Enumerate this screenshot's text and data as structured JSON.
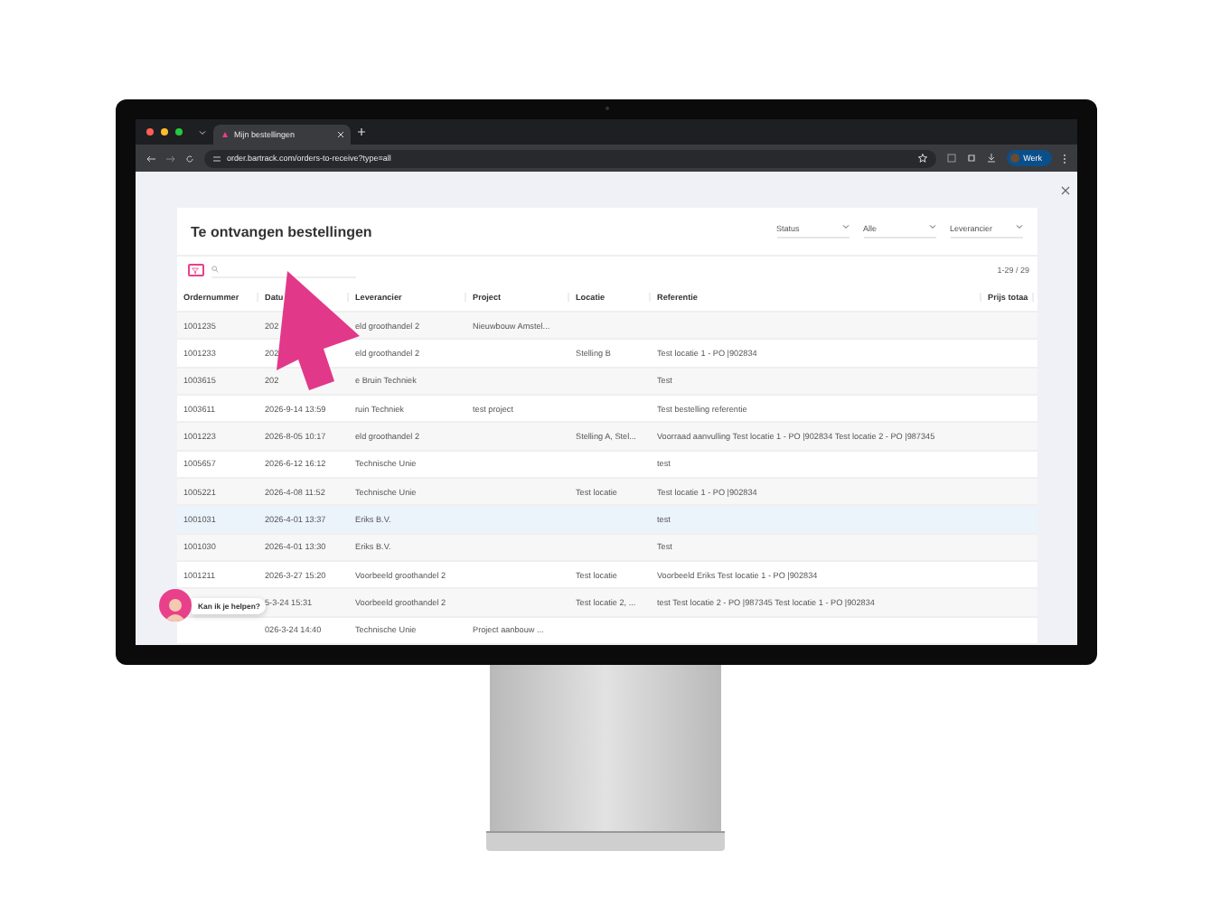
{
  "browser": {
    "tab": {
      "title": "Mijn bestellingen"
    },
    "url": "order.bartrack.com/orders-to-receive?type=all",
    "profile": "Werk"
  },
  "page": {
    "title": "Te ontvangen bestellingen",
    "filters": [
      {
        "label": "Status"
      },
      {
        "label": "Alle"
      },
      {
        "label": "Leverancier"
      }
    ],
    "count": "1-29 / 29",
    "columns": [
      "Ordernummer",
      "Datu",
      "Leverancier",
      "Project",
      "Locatie",
      "Referentie",
      "Prijs totaa"
    ],
    "rows": [
      {
        "number": "1001235",
        "date": "202",
        "supplier": "eld groothandel 2",
        "project": "Nieuwbouw Amstel...",
        "selected": false
      },
      {
        "number": "1001233",
        "date": "202",
        "supplier": "eld groothandel 2",
        "location": "Stelling B",
        "reference": "Test locatie 1 - PO |902834",
        "selected": false
      },
      {
        "number": "1003615",
        "date": "202",
        "supplier": "e Bruin Techniek",
        "reference": "Test",
        "selected": false
      },
      {
        "number": "1003611",
        "date": "2026-9-14 13:59",
        "supplier": "ruin Techniek",
        "project": "test project",
        "reference": "Test bestelling referentie",
        "selected": false
      },
      {
        "number": "1001223",
        "date": "2026-8-05 10:17",
        "supplier": "eld groothandel 2",
        "location": "Stelling A, Stel...",
        "reference": "Voorraad aanvulling Test locatie 1 - PO |902834 Test locatie 2 - PO |987345",
        "selected": false
      },
      {
        "number": "1005657",
        "date": "2026-6-12 16:12",
        "supplier": "Technische Unie",
        "reference": "test",
        "selected": false
      },
      {
        "number": "1005221",
        "date": "2026-4-08 11:52",
        "supplier": "Technische Unie",
        "location": "Test locatie",
        "reference": "Test locatie 1 - PO |902834",
        "selected": false
      },
      {
        "number": "1001031",
        "date": "2026-4-01 13:37",
        "supplier": "Eriks B.V.",
        "reference": "test",
        "selected": true
      },
      {
        "number": "1001030",
        "date": "2026-4-01 13:30",
        "supplier": "Eriks B.V.",
        "reference": "Test",
        "selected": false
      },
      {
        "number": "1001211",
        "date": "2026-3-27 15:20",
        "supplier": "Voorbeeld groothandel 2",
        "location": "Test locatie",
        "reference": "Voorbeeld Eriks Test locatie 1 - PO |902834",
        "selected": false
      },
      {
        "date": "5-3-24 15:31",
        "supplier": "Voorbeeld groothandel 2",
        "location": "Test locatie 2, ...",
        "reference": "test Test locatie 2 - PO |987345 Test locatie 1 - PO |902834",
        "selected": false
      },
      {
        "date": "026-3-24 14:40",
        "supplier": "Technische Unie",
        "project": "Project aanbouw ...",
        "selected": false
      }
    ]
  },
  "chat": {
    "message": "Kan ik je helpen?"
  }
}
